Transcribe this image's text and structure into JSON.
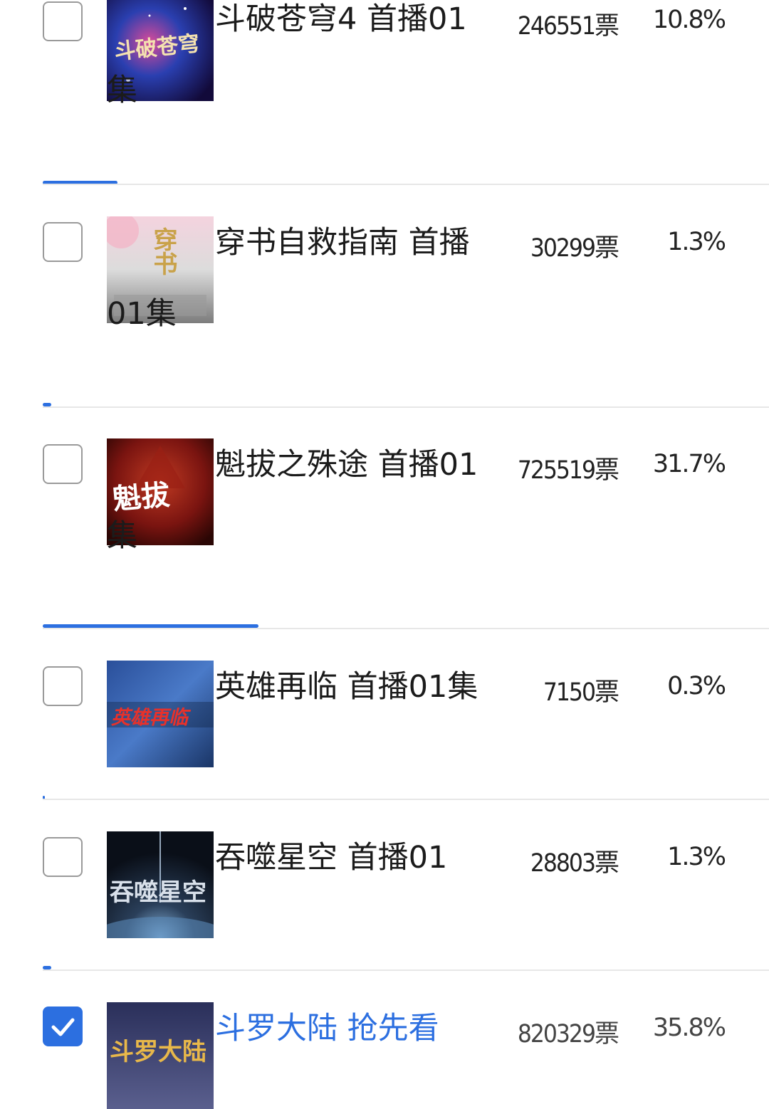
{
  "items": [
    {
      "title": "斗破苍穹4 首播01集",
      "votes": "246551票",
      "pct": "10.8%",
      "share": 0.108,
      "checked": false,
      "thumb_text": "斗破苍穹",
      "thumb_colors": [
        "#2b1a57",
        "#1a3b9a",
        "#8b2d6e"
      ]
    },
    {
      "title": "穿书自救指南 首播01集",
      "votes": "30299票",
      "pct": "1.3%",
      "share": 0.013,
      "checked": false,
      "thumb_text": "穿书",
      "thumb_colors": [
        "#f0d9e2",
        "#c8c8c8",
        "#8a8a8a"
      ]
    },
    {
      "title": "魁拔之殊途 首播01集",
      "votes": "725519票",
      "pct": "31.7%",
      "share": 0.317,
      "checked": false,
      "thumb_text": "魁拔",
      "thumb_colors": [
        "#7a1410",
        "#b8261a",
        "#3b0a07"
      ]
    },
    {
      "title": "英雄再临 首播01集",
      "votes": "7150票",
      "pct": "0.3%",
      "share": 0.003,
      "checked": false,
      "thumb_text": "英雄再临",
      "thumb_colors": [
        "#1f3f7a",
        "#3f6fbf",
        "#142a52"
      ]
    },
    {
      "title": "吞噬星空 首播01",
      "votes": "28803票",
      "pct": "1.3%",
      "share": 0.013,
      "checked": false,
      "thumb_text": "吞噬星空",
      "thumb_colors": [
        "#0f1a2a",
        "#3a4a6a",
        "#7aa0c8"
      ]
    },
    {
      "title": "斗罗大陆 抢先看",
      "votes": "820329票",
      "pct": "35.8%",
      "share": 0.358,
      "checked": true,
      "thumb_text": "斗罗大陆",
      "thumb_colors": [
        "#1a1c3a",
        "#3a3f6e",
        "#c89a3a"
      ]
    }
  ]
}
